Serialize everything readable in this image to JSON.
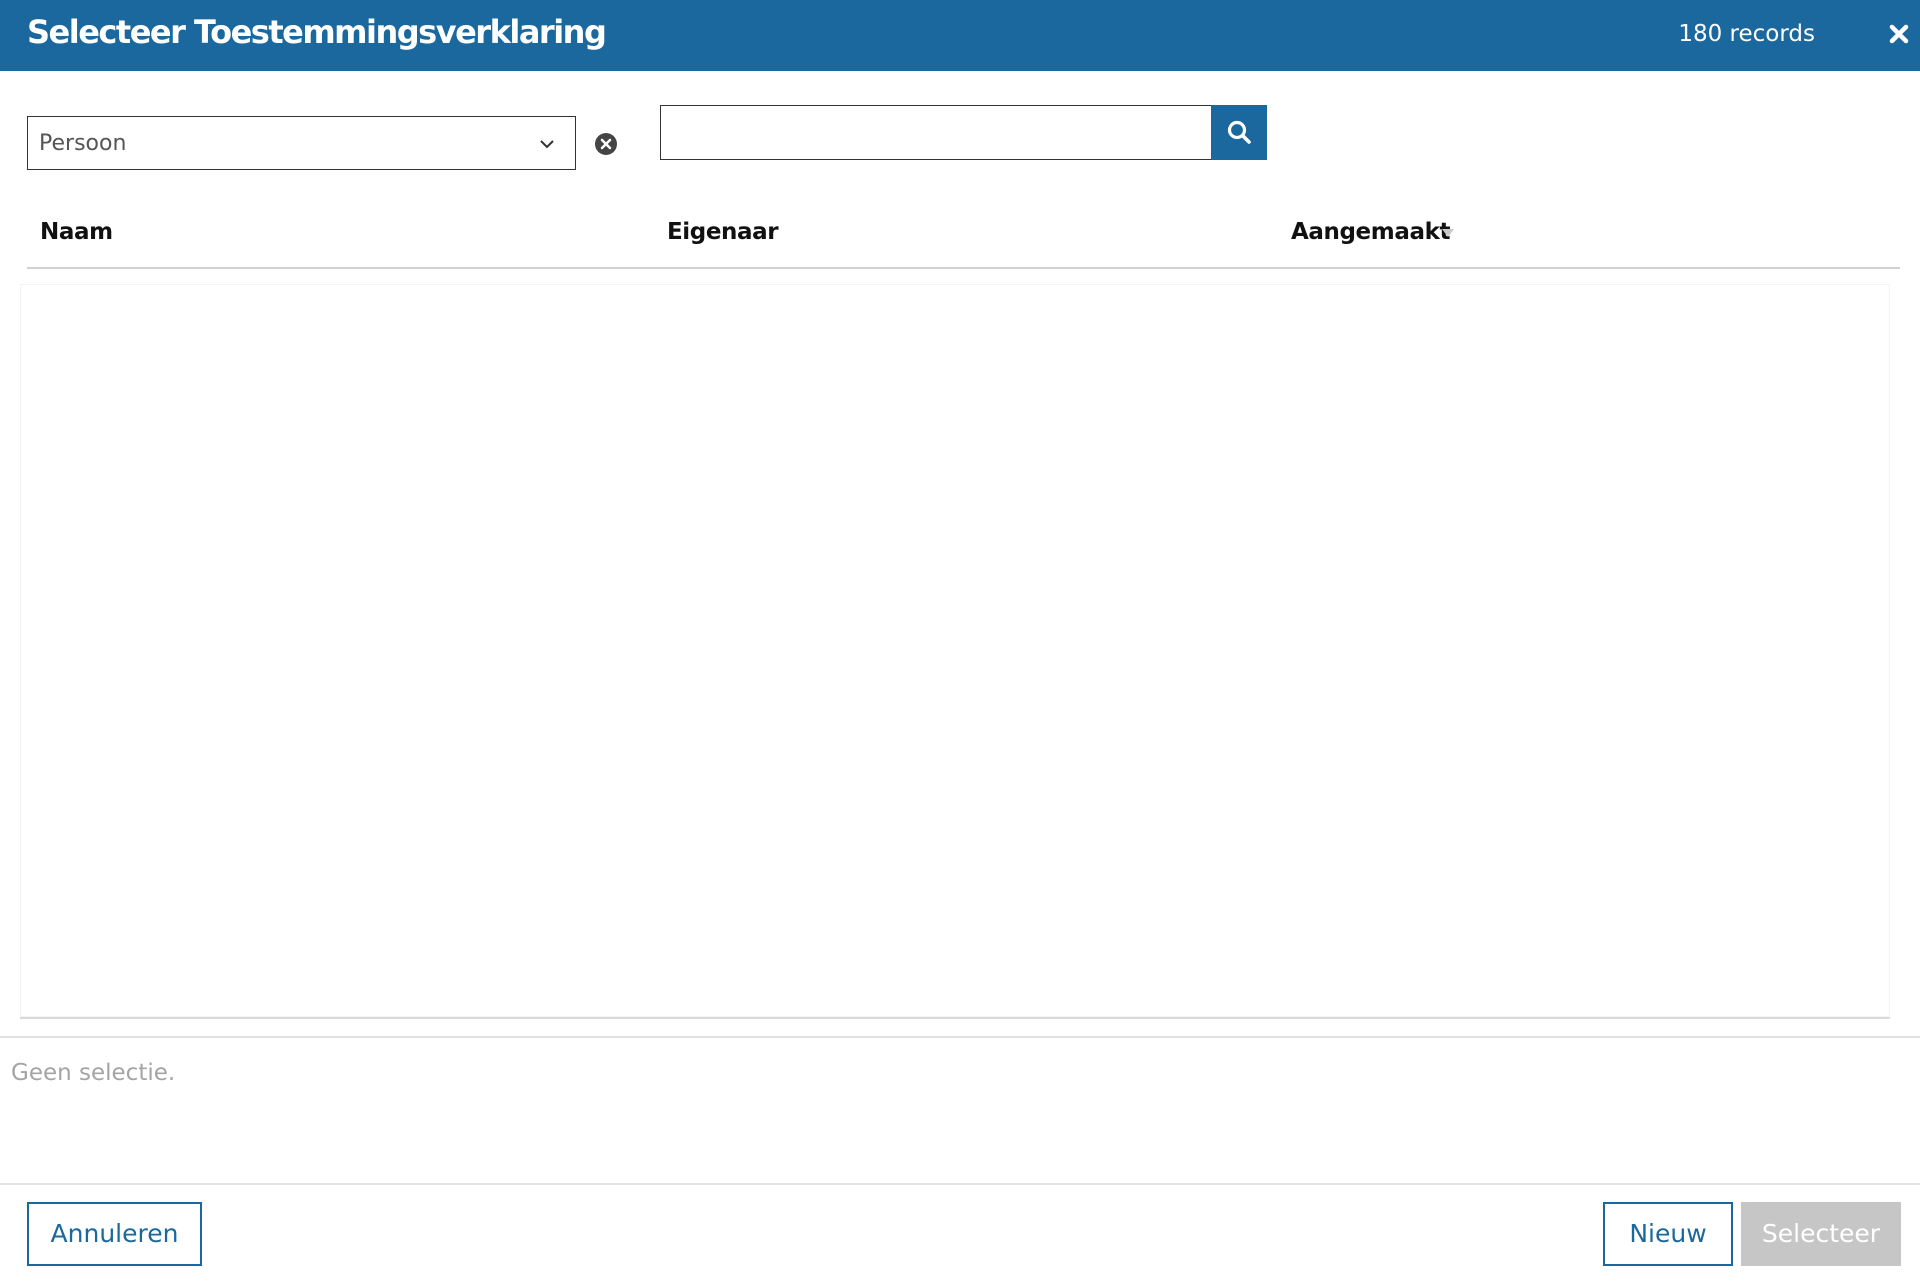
{
  "dialog": {
    "title": "Selecteer Toestemmingsverklaring",
    "record_count": "180 records",
    "close_icon": "close-icon",
    "header_color": "#1b689f"
  },
  "filter": {
    "selected": "Persoon",
    "chevron_icon": "chevron-down-icon",
    "clear_icon": "clear-circle-icon"
  },
  "search": {
    "value": "",
    "placeholder": "",
    "button_icon": "search-icon"
  },
  "table": {
    "columns": [
      "Naam",
      "Eigenaar",
      "Aangemaakt"
    ],
    "sorted_column": "Aangemaakt",
    "sort_direction": "descending",
    "rows": []
  },
  "selection": {
    "status": "Geen selectie."
  },
  "footer": {
    "cancel_label": "Annuleren",
    "new_label": "Nieuw",
    "select_label": "Selecteer",
    "select_enabled": false
  }
}
